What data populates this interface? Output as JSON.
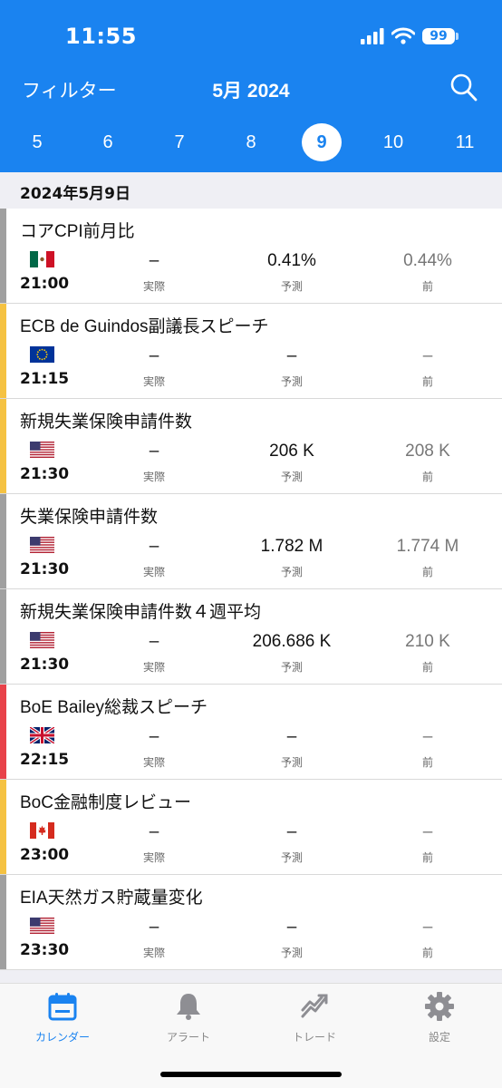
{
  "status_bar": {
    "time": "11:55",
    "battery": "99"
  },
  "nav": {
    "filter_label": "フィルター",
    "month_label": "5月 2024"
  },
  "days": [
    {
      "label": "5",
      "selected": false
    },
    {
      "label": "6",
      "selected": false
    },
    {
      "label": "7",
      "selected": false
    },
    {
      "label": "8",
      "selected": false
    },
    {
      "label": "9",
      "selected": true
    },
    {
      "label": "10",
      "selected": false
    },
    {
      "label": "11",
      "selected": false
    }
  ],
  "date_header": "2024年5月9日",
  "labels": {
    "actual": "実際",
    "forecast": "予測",
    "previous": "前"
  },
  "colors": {
    "accent": "#1a83f0",
    "impact_low": "#a0a0a0",
    "impact_medium": "#f5c242",
    "impact_high": "#e8424a"
  },
  "events": [
    {
      "title": "コアCPI前月比",
      "time": "21:00",
      "country": "mexico-flag",
      "impact": "impact_low",
      "actual": "–",
      "forecast": "0.41%",
      "previous": "0.44%"
    },
    {
      "title": "ECB de Guindos副議長スピーチ",
      "time": "21:15",
      "country": "eu-flag",
      "impact": "impact_medium",
      "actual": "–",
      "forecast": "–",
      "previous": "–"
    },
    {
      "title": "新規失業保険申請件数",
      "time": "21:30",
      "country": "us-flag",
      "impact": "impact_medium",
      "actual": "–",
      "forecast": "206 K",
      "previous": "208 K"
    },
    {
      "title": "失業保険申請件数",
      "time": "21:30",
      "country": "us-flag",
      "impact": "impact_low",
      "actual": "–",
      "forecast": "1.782 M",
      "previous": "1.774 M"
    },
    {
      "title": "新規失業保険申請件数４週平均",
      "time": "21:30",
      "country": "us-flag",
      "impact": "impact_low",
      "actual": "–",
      "forecast": "206.686 K",
      "previous": "210 K"
    },
    {
      "title": "BoE Bailey総裁スピーチ",
      "time": "22:15",
      "country": "uk-flag",
      "impact": "impact_high",
      "actual": "–",
      "forecast": "–",
      "previous": "–"
    },
    {
      "title": "BoC金融制度レビュー",
      "time": "23:00",
      "country": "canada-flag",
      "impact": "impact_medium",
      "actual": "–",
      "forecast": "–",
      "previous": "–"
    },
    {
      "title": "EIA天然ガス貯蔵量変化",
      "time": "23:30",
      "country": "us-flag",
      "impact": "impact_low",
      "actual": "–",
      "forecast": "–",
      "previous": "–"
    }
  ],
  "tabs": [
    {
      "label": "カレンダー",
      "icon": "calendar-icon",
      "active": true
    },
    {
      "label": "アラート",
      "icon": "bell-icon",
      "active": false
    },
    {
      "label": "トレード",
      "icon": "trade-icon",
      "active": false
    },
    {
      "label": "設定",
      "icon": "gear-icon",
      "active": false
    }
  ]
}
